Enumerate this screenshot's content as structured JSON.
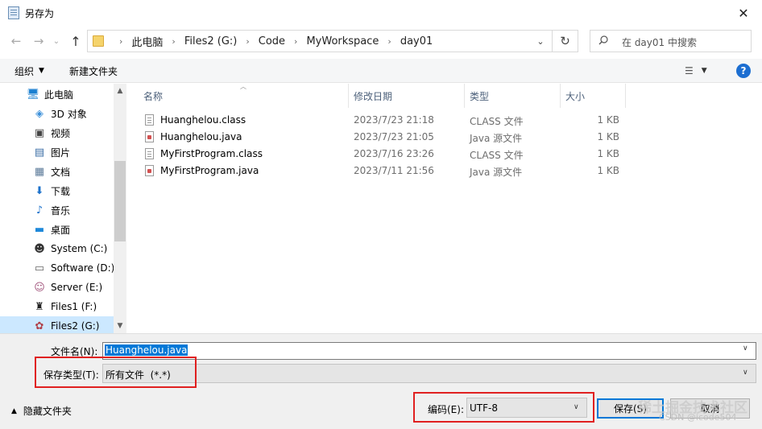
{
  "window": {
    "title": "另存为",
    "close_glyph": "✕"
  },
  "address": {
    "crumbs": [
      "此电脑",
      "Files2 (G:)",
      "Code",
      "MyWorkspace",
      "day01"
    ],
    "separator": "›",
    "search_placeholder": "在 day01 中搜索"
  },
  "toolbar": {
    "organize_label": "组织",
    "new_folder_label": "新建文件夹"
  },
  "sidebar": {
    "items": [
      {
        "label": "此电脑",
        "icon": "computer-icon"
      },
      {
        "label": "3D 对象",
        "icon": "cube-icon"
      },
      {
        "label": "视频",
        "icon": "video-icon"
      },
      {
        "label": "图片",
        "icon": "picture-icon"
      },
      {
        "label": "文档",
        "icon": "document-icon"
      },
      {
        "label": "下载",
        "icon": "download-icon"
      },
      {
        "label": "音乐",
        "icon": "music-icon"
      },
      {
        "label": "桌面",
        "icon": "desktop-icon"
      },
      {
        "label": "System (C:)",
        "icon": "drive-icon"
      },
      {
        "label": "Software (D:)",
        "icon": "drive-icon"
      },
      {
        "label": "Server (E:)",
        "icon": "drive-icon"
      },
      {
        "label": "Files1 (F:)",
        "icon": "drive-icon"
      },
      {
        "label": "Files2 (G:)",
        "icon": "drive-icon",
        "selected": true
      }
    ]
  },
  "files": {
    "columns": [
      "名称",
      "修改日期",
      "类型",
      "大小"
    ],
    "rows": [
      {
        "name": "Huanghelou.class",
        "date": "2023/7/23 21:18",
        "type": "CLASS 文件",
        "size": "1 KB",
        "kind": "class"
      },
      {
        "name": "Huanghelou.java",
        "date": "2023/7/23 21:05",
        "type": "Java 源文件",
        "size": "1 KB",
        "kind": "java"
      },
      {
        "name": "MyFirstProgram.class",
        "date": "2023/7/16 23:26",
        "type": "CLASS 文件",
        "size": "1 KB",
        "kind": "class"
      },
      {
        "name": "MyFirstProgram.java",
        "date": "2023/7/11 21:56",
        "type": "Java 源文件",
        "size": "1 KB",
        "kind": "java"
      }
    ]
  },
  "form": {
    "filename_label": "文件名(N):",
    "filename_value": "Huanghelou.java",
    "filetype_label": "保存类型(T):",
    "filetype_value": "所有文件  (*.*)",
    "hide_folders_label": "隐藏文件夹",
    "encoding_label": "编码(E):",
    "encoding_value": "UTF-8",
    "save_label": "保存(S)",
    "cancel_label": "取消"
  },
  "watermark": {
    "line1": "稀土掘金技术社区",
    "line2": "CSDN @icode504"
  },
  "colors": {
    "accent": "#0078d7",
    "highlight": "#e02020",
    "selected_bg": "#cce8ff"
  }
}
